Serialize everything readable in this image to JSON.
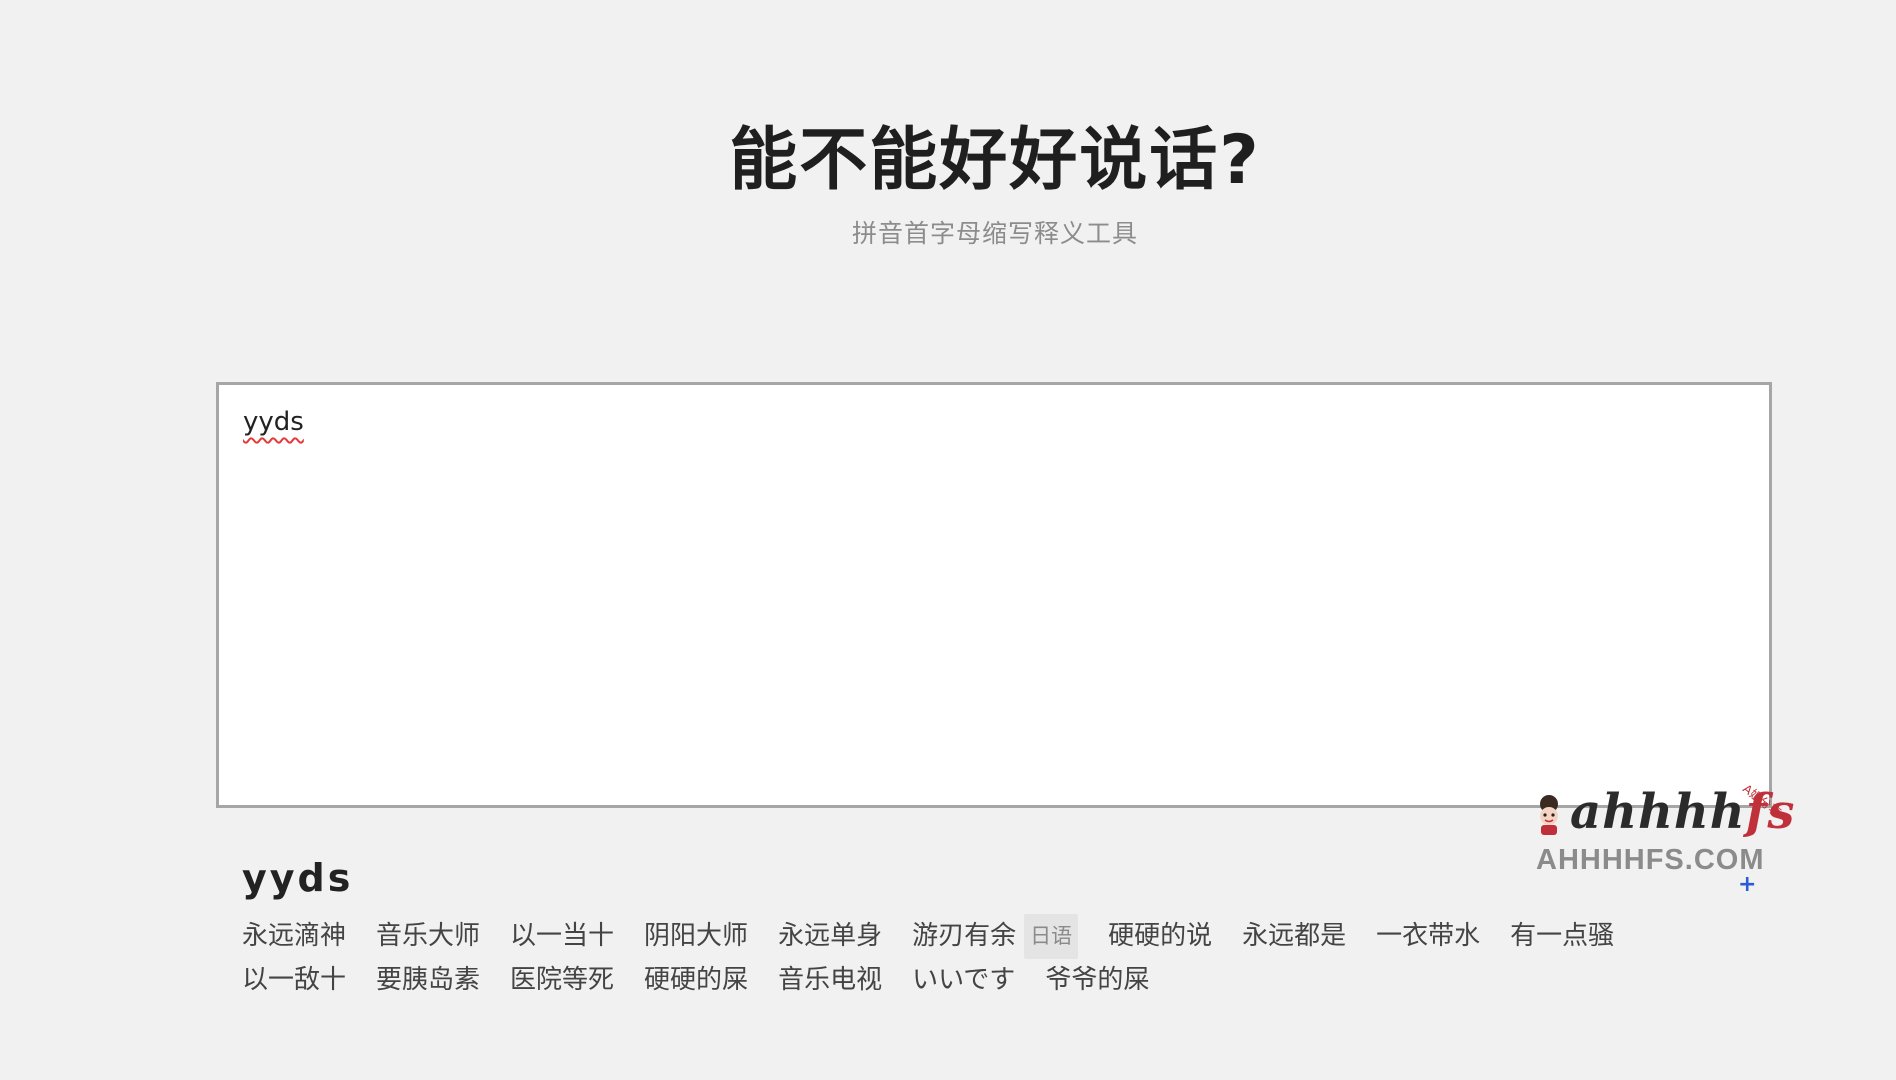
{
  "header": {
    "title": "能不能好好说话?",
    "subtitle": "拼音首字母缩写释义工具"
  },
  "input": {
    "value": "yyds"
  },
  "result": {
    "key": "yyds",
    "tags": [
      {
        "text": "永远滴神"
      },
      {
        "text": "音乐大师"
      },
      {
        "text": "以一当十"
      },
      {
        "text": "阴阳大师"
      },
      {
        "text": "永远单身"
      },
      {
        "text": "游刃有余",
        "lang": "日语"
      },
      {
        "text": "硬硬的说"
      },
      {
        "text": "永远都是"
      },
      {
        "text": "一衣带水"
      },
      {
        "text": "有一点骚"
      },
      {
        "text": "以一敌十"
      },
      {
        "text": "要胰岛素"
      },
      {
        "text": "医院等死"
      },
      {
        "text": "硬硬的屎"
      },
      {
        "text": "音乐电视"
      },
      {
        "text": "いいです"
      },
      {
        "text": "爷爷的屎"
      }
    ]
  },
  "watermark": {
    "script_main": "ahhhh",
    "script_accent": "fs",
    "badge": "A姐分享",
    "domain": "AHHHHFS.COM",
    "plus": "+",
    "accent_color": "#c0303a"
  }
}
